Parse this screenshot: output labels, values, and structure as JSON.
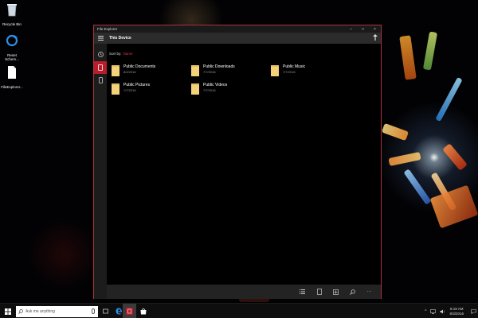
{
  "desktop": {
    "icons": [
      {
        "label": "Recycle Bin"
      },
      {
        "label": "Reset\nSchem..."
      },
      {
        "label": "FileExplorer..."
      }
    ]
  },
  "window": {
    "title": "File Explorer",
    "controls": {
      "minimize": "–",
      "maximize": "□",
      "close": "×"
    },
    "location": "This Device",
    "sort_label": "Sort by:",
    "sort_value": "Name",
    "folders": [
      {
        "name": "Public Documents",
        "date": "8/2/2016"
      },
      {
        "name": "Public Downloads",
        "date": "7/7/2016"
      },
      {
        "name": "Public Music",
        "date": "7/7/2016"
      },
      {
        "name": "Public Pictures",
        "date": "7/7/2016"
      },
      {
        "name": "Public Videos",
        "date": "7/7/2016"
      }
    ],
    "commands": [
      "list-view-icon",
      "new-item-icon",
      "select-icon",
      "search-icon",
      "more-icon"
    ],
    "more_label": "···"
  },
  "taskbar": {
    "search_placeholder": "Ask me anything",
    "clock_time": "8:19 AM",
    "clock_date": "8/3/2016"
  },
  "colors": {
    "accent": "#b91d2b",
    "folder": "#f3d27a",
    "window_border": "#b0303a"
  }
}
